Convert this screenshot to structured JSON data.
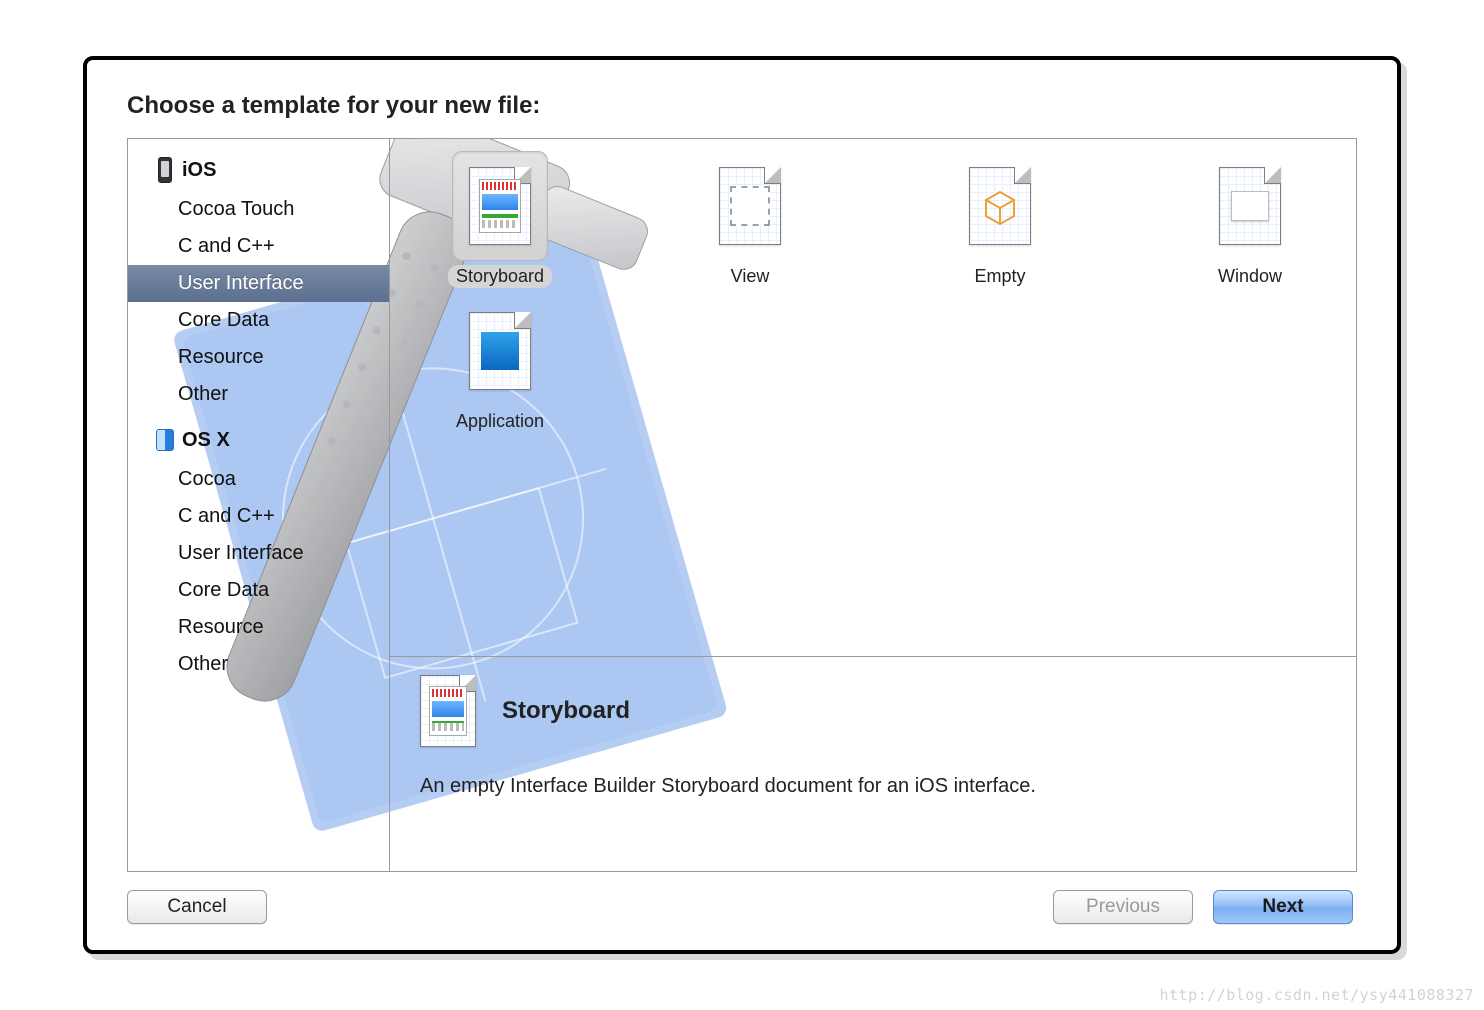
{
  "heading": "Choose a template for your new file:",
  "sidebar": {
    "groups": [
      {
        "id": "ios",
        "label": "iOS",
        "icon": "iphone-icon",
        "items": [
          {
            "label": "Cocoa Touch",
            "selected": false
          },
          {
            "label": "C and C++",
            "selected": false
          },
          {
            "label": "User Interface",
            "selected": true
          },
          {
            "label": "Core Data",
            "selected": false
          },
          {
            "label": "Resource",
            "selected": false
          },
          {
            "label": "Other",
            "selected": false
          }
        ]
      },
      {
        "id": "osx",
        "label": "OS X",
        "icon": "finder-icon",
        "items": [
          {
            "label": "Cocoa",
            "selected": false
          },
          {
            "label": "C and C++",
            "selected": false
          },
          {
            "label": "User Interface",
            "selected": false
          },
          {
            "label": "Core Data",
            "selected": false
          },
          {
            "label": "Resource",
            "selected": false
          },
          {
            "label": "Other",
            "selected": false
          }
        ]
      }
    ]
  },
  "templates": [
    {
      "id": "storyboard",
      "label": "Storyboard",
      "icon": "storyboard-icon",
      "selected": true
    },
    {
      "id": "view",
      "label": "View",
      "icon": "view-icon",
      "selected": false
    },
    {
      "id": "empty",
      "label": "Empty",
      "icon": "empty-icon",
      "selected": false
    },
    {
      "id": "window",
      "label": "Window",
      "icon": "window-icon",
      "selected": false
    },
    {
      "id": "application",
      "label": "Application",
      "icon": "application-icon",
      "selected": false
    }
  ],
  "detail": {
    "title": "Storyboard",
    "icon": "storyboard-icon",
    "description": "An empty Interface Builder Storyboard document for an iOS interface."
  },
  "buttons": {
    "cancel": "Cancel",
    "previous": "Previous",
    "next": "Next"
  },
  "watermark": "http://blog.csdn.net/ysy441088327"
}
